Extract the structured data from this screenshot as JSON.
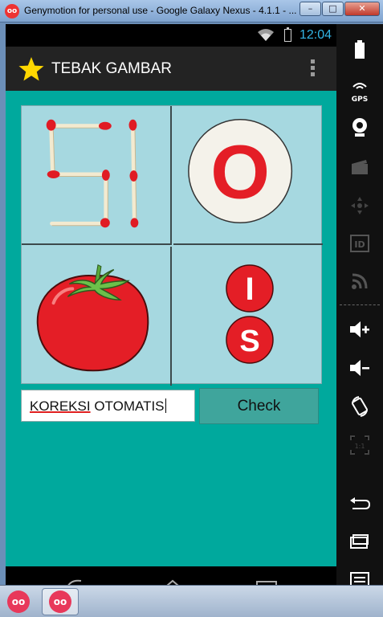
{
  "window": {
    "title": "Genymotion for personal use - Google Galaxy Nexus - 4.1.1 - ...",
    "minimize_icon": "minimize-icon",
    "maximize_icon": "maximize-icon",
    "close_icon": "close-icon"
  },
  "statusbar": {
    "time": "12:04",
    "time_color": "#33b5e5"
  },
  "actionbar": {
    "title": "TEBAK GAMBAR",
    "star_color": "#ffd700"
  },
  "puzzle": {
    "cells": [
      {
        "name": "matchstick-si",
        "content": "matchstick digits"
      },
      {
        "name": "o-badge",
        "letter": "O"
      },
      {
        "name": "tomato",
        "content": "tomato"
      },
      {
        "name": "is-badges",
        "letters": [
          "I",
          "S"
        ]
      }
    ],
    "badge_color": "#e41e26"
  },
  "answer": {
    "value_underlined": "KOREKSI",
    "value_rest": " OTOMATIS"
  },
  "check_button": {
    "label": "Check"
  },
  "sidebar": {
    "items": [
      {
        "icon": "battery-icon"
      },
      {
        "icon": "gps-icon",
        "label": "GPS"
      },
      {
        "icon": "webcam-icon"
      },
      {
        "icon": "video-icon"
      },
      {
        "icon": "dpad-icon"
      },
      {
        "icon": "id-icon",
        "label": "ID"
      },
      {
        "icon": "rss-icon"
      },
      {
        "icon": "volume-up-icon"
      },
      {
        "icon": "volume-down-icon"
      },
      {
        "icon": "rotate-icon"
      },
      {
        "icon": "scale-icon",
        "label": "1:1"
      },
      {
        "icon": "back-icon"
      },
      {
        "icon": "home-icon"
      },
      {
        "icon": "menu-icon"
      }
    ]
  },
  "colors": {
    "content_bg": "#00a99d",
    "puzzle_bg": "#a6d8e0",
    "check_bg": "#3fa59c"
  }
}
